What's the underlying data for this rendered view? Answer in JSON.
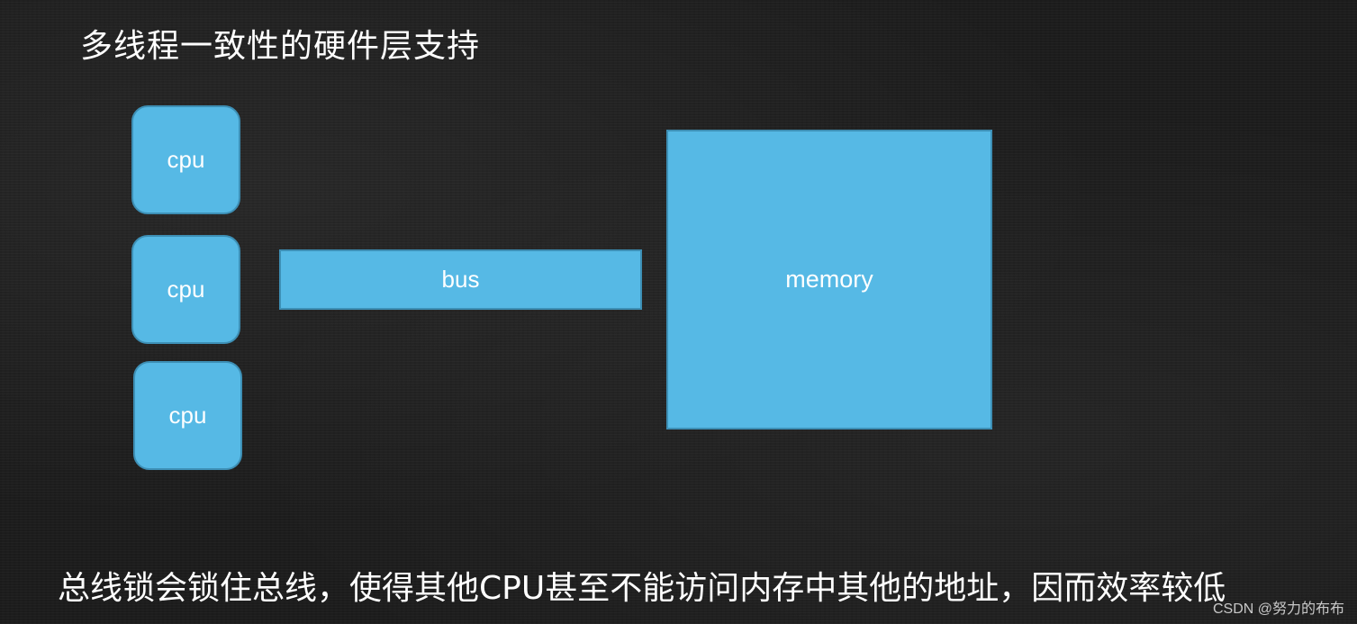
{
  "slide": {
    "title": "多线程一致性的硬件层支持",
    "footer": "总线锁会锁住总线，使得其他CPU甚至不能访问内存中其他的地址，因而效率较低",
    "watermark": "CSDN @努力的布布"
  },
  "diagram": {
    "colors": {
      "box_fill": "#56b9e5",
      "box_border": "#3d8fb5",
      "text": "#ffffff",
      "background": "#1d1d1d"
    },
    "cpus": [
      {
        "label": "cpu"
      },
      {
        "label": "cpu"
      },
      {
        "label": "cpu"
      }
    ],
    "bus": {
      "label": "bus"
    },
    "memory": {
      "label": "memory"
    }
  }
}
